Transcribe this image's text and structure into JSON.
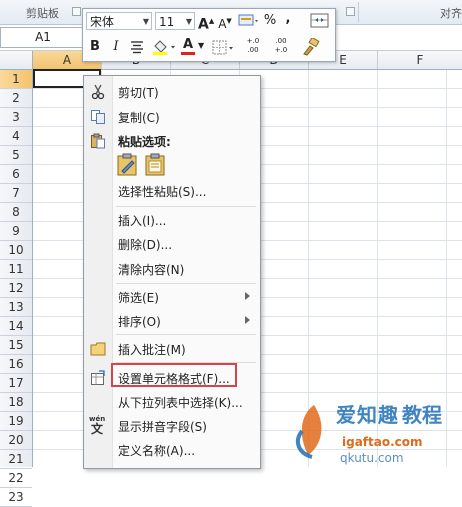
{
  "ribbon": {
    "group_clipboard": "剪贴板",
    "group_align": "对齐"
  },
  "formula_bar": {
    "name_box": "A1"
  },
  "grid": {
    "columns": [
      "A",
      "B",
      "C",
      "D",
      "E",
      "F"
    ],
    "rows": [
      "1",
      "2",
      "3",
      "4",
      "5",
      "6",
      "7",
      "8",
      "9",
      "10",
      "11",
      "12",
      "13",
      "14",
      "15",
      "16",
      "17",
      "18",
      "19",
      "20",
      "21",
      "22",
      "23"
    ],
    "active_cell": "A1"
  },
  "mini_toolbar": {
    "font_name": "宋体",
    "font_size": "11",
    "grow_font": "A",
    "shrink_font": "A",
    "percent": "%",
    "comma": ",",
    "bold": "B",
    "italic": "I",
    "font_color_letter": "A",
    "increase_decimal": "+.0 .00",
    "decrease_decimal": ".00 +.0"
  },
  "context_menu": {
    "items": [
      {
        "label": "剪切(T)",
        "icon": "scissors-icon"
      },
      {
        "label": "复制(C)",
        "icon": "copy-icon"
      },
      {
        "label": "粘贴选项:",
        "icon": "paste-icon"
      },
      {
        "label": "选择性粘贴(S)...",
        "icon": ""
      },
      {
        "label": "插入(I)...",
        "icon": ""
      },
      {
        "label": "删除(D)...",
        "icon": ""
      },
      {
        "label": "清除内容(N)",
        "icon": ""
      },
      {
        "label": "筛选(E)",
        "icon": "",
        "submenu": true
      },
      {
        "label": "排序(O)",
        "icon": "",
        "submenu": true
      },
      {
        "label": "插入批注(M)",
        "icon": "comment-icon"
      },
      {
        "label": "设置单元格格式(F)...",
        "icon": "format-cells-icon",
        "highlighted": true
      },
      {
        "label": "从下拉列表中选择(K)...",
        "icon": ""
      },
      {
        "label": "显示拼音字段(S)",
        "icon": "phonetic-icon"
      },
      {
        "label": "定义名称(A)...",
        "icon": ""
      }
    ],
    "phonetic_icon_text": "wén"
  },
  "watermark": {
    "line1": "爱知趣",
    "line2": "教程",
    "line3": "igaftao.com",
    "line4": "qkutu.com"
  },
  "colors": {
    "highlight_border": "#d2454c",
    "active_header": "#f2c36e",
    "watermark_blue": "#1f6fb6",
    "watermark_orange": "#e06a1b"
  }
}
